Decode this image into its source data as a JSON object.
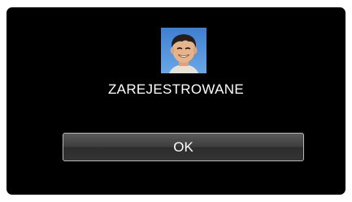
{
  "dialog": {
    "message": "ZAREJESTROWANE",
    "ok_label": "OK",
    "thumbnail_icon": "registered-face-thumbnail"
  },
  "colors": {
    "screen_background": "#000000",
    "text": "#ffffff",
    "button_border": "#b9b9b9"
  }
}
